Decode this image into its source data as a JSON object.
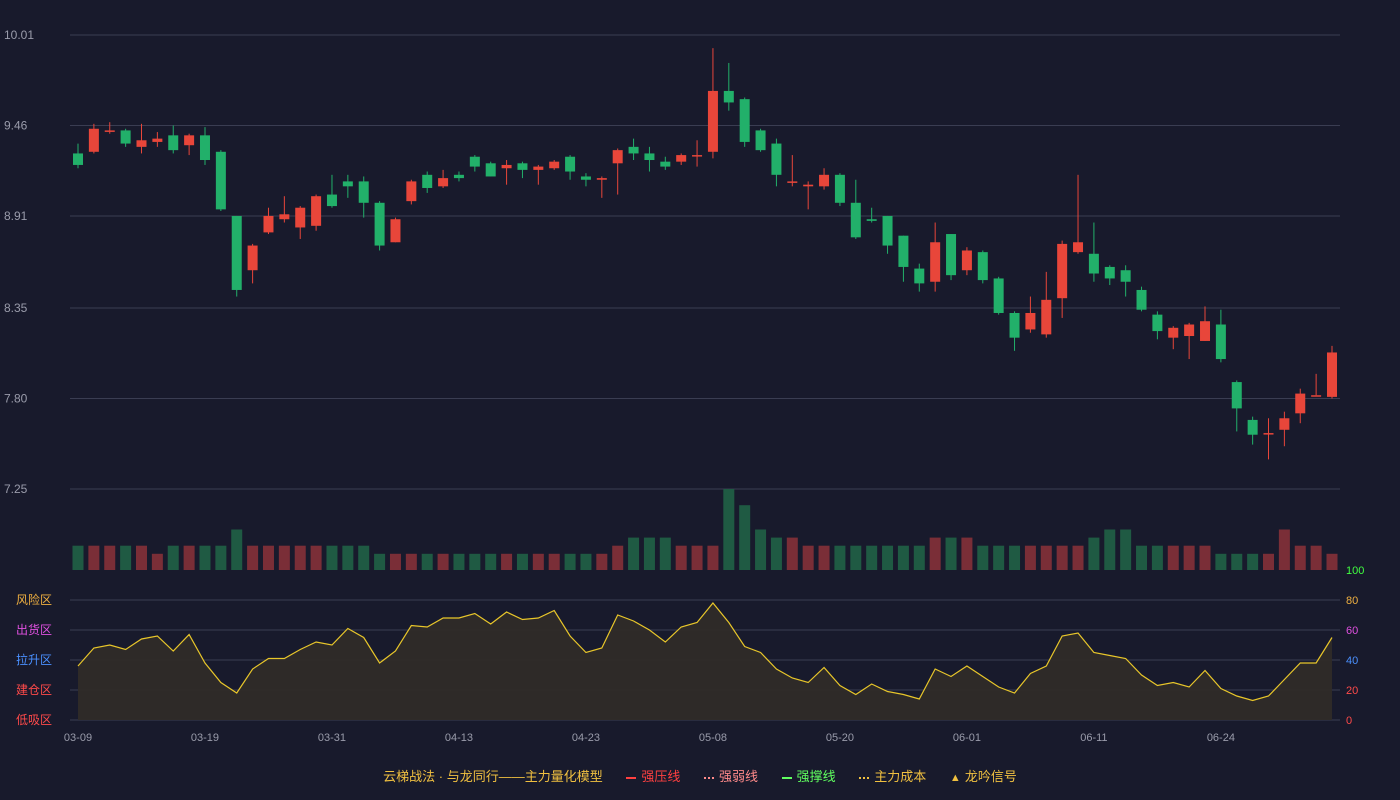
{
  "chart_data": {
    "type": "candlestick",
    "price_axis": {
      "ticks": [
        10.01,
        9.46,
        8.91,
        8.35,
        7.8,
        7.25
      ],
      "ylim": [
        7.25,
        10.01
      ]
    },
    "date_ticks": [
      "03-09",
      "03-19",
      "03-31",
      "04-13",
      "04-23",
      "05-08",
      "05-20",
      "06-01",
      "06-11",
      "06-24"
    ],
    "candles": [
      [
        9.29,
        9.22,
        9.35,
        9.2
      ],
      [
        9.3,
        9.44,
        9.47,
        9.29
      ],
      [
        9.43,
        9.43,
        9.48,
        9.41
      ],
      [
        9.43,
        9.35,
        9.44,
        9.33
      ],
      [
        9.33,
        9.37,
        9.47,
        9.29
      ],
      [
        9.36,
        9.38,
        9.42,
        9.33
      ],
      [
        9.4,
        9.31,
        9.46,
        9.29
      ],
      [
        9.34,
        9.4,
        9.41,
        9.28
      ],
      [
        9.4,
        9.25,
        9.45,
        9.22
      ],
      [
        9.3,
        8.95,
        9.31,
        8.94
      ],
      [
        8.91,
        8.46,
        8.91,
        8.42
      ],
      [
        8.58,
        8.73,
        8.74,
        8.5
      ],
      [
        8.81,
        8.91,
        8.96,
        8.8
      ],
      [
        8.89,
        8.92,
        9.03,
        8.87
      ],
      [
        8.84,
        8.96,
        8.97,
        8.77
      ],
      [
        8.85,
        9.03,
        9.04,
        8.82
      ],
      [
        9.04,
        8.97,
        9.16,
        8.96
      ],
      [
        9.12,
        9.09,
        9.16,
        9.02
      ],
      [
        9.12,
        8.99,
        9.15,
        8.9
      ],
      [
        8.99,
        8.73,
        9.0,
        8.7
      ],
      [
        8.75,
        8.89,
        8.9,
        8.75
      ],
      [
        9.0,
        9.12,
        9.13,
        8.98
      ],
      [
        9.16,
        9.08,
        9.18,
        9.05
      ],
      [
        9.09,
        9.14,
        9.19,
        9.08
      ],
      [
        9.16,
        9.14,
        9.18,
        9.12
      ],
      [
        9.27,
        9.21,
        9.28,
        9.18
      ],
      [
        9.23,
        9.15,
        9.24,
        9.15
      ],
      [
        9.2,
        9.22,
        9.25,
        9.1
      ],
      [
        9.23,
        9.19,
        9.24,
        9.14
      ],
      [
        9.19,
        9.21,
        9.22,
        9.1
      ],
      [
        9.2,
        9.24,
        9.25,
        9.19
      ],
      [
        9.27,
        9.18,
        9.28,
        9.13
      ],
      [
        9.15,
        9.13,
        9.17,
        9.09
      ],
      [
        9.13,
        9.14,
        9.15,
        9.02
      ],
      [
        9.23,
        9.31,
        9.32,
        9.04
      ],
      [
        9.33,
        9.29,
        9.38,
        9.25
      ],
      [
        9.29,
        9.25,
        9.33,
        9.18
      ],
      [
        9.24,
        9.21,
        9.27,
        9.19
      ],
      [
        9.24,
        9.28,
        9.29,
        9.22
      ],
      [
        9.28,
        9.28,
        9.37,
        9.21
      ],
      [
        9.3,
        9.67,
        9.93,
        9.26
      ],
      [
        9.67,
        9.6,
        9.84,
        9.55
      ],
      [
        9.62,
        9.36,
        9.63,
        9.33
      ],
      [
        9.43,
        9.31,
        9.44,
        9.3
      ],
      [
        9.35,
        9.16,
        9.38,
        9.09
      ],
      [
        9.12,
        9.12,
        9.28,
        9.09
      ],
      [
        9.09,
        9.1,
        9.12,
        8.95
      ],
      [
        9.09,
        9.16,
        9.2,
        9.07
      ],
      [
        9.16,
        8.99,
        9.17,
        8.97
      ],
      [
        8.99,
        8.78,
        9.13,
        8.77
      ],
      [
        8.89,
        8.88,
        8.96,
        8.87
      ],
      [
        8.91,
        8.73,
        8.91,
        8.68
      ],
      [
        8.79,
        8.6,
        8.79,
        8.51
      ],
      [
        8.59,
        8.5,
        8.62,
        8.45
      ],
      [
        8.51,
        8.75,
        8.87,
        8.45
      ],
      [
        8.8,
        8.55,
        8.8,
        8.52
      ],
      [
        8.58,
        8.7,
        8.72,
        8.55
      ],
      [
        8.69,
        8.52,
        8.7,
        8.5
      ],
      [
        8.53,
        8.32,
        8.54,
        8.31
      ],
      [
        8.32,
        8.17,
        8.33,
        8.09
      ],
      [
        8.22,
        8.32,
        8.42,
        8.2
      ],
      [
        8.19,
        8.4,
        8.57,
        8.17
      ],
      [
        8.41,
        8.74,
        8.76,
        8.29
      ],
      [
        8.69,
        8.75,
        9.16,
        8.68
      ],
      [
        8.68,
        8.56,
        8.87,
        8.51
      ],
      [
        8.6,
        8.53,
        8.61,
        8.49
      ],
      [
        8.58,
        8.51,
        8.61,
        8.42
      ],
      [
        8.46,
        8.34,
        8.48,
        8.33
      ],
      [
        8.31,
        8.21,
        8.33,
        8.16
      ],
      [
        8.17,
        8.23,
        8.24,
        8.1
      ],
      [
        8.18,
        8.25,
        8.26,
        8.04
      ],
      [
        8.15,
        8.27,
        8.36,
        8.15
      ],
      [
        8.25,
        8.04,
        8.34,
        8.02
      ],
      [
        7.9,
        7.74,
        7.91,
        7.6
      ],
      [
        7.67,
        7.58,
        7.69,
        7.52
      ],
      [
        7.59,
        7.59,
        7.68,
        7.43
      ],
      [
        7.61,
        7.68,
        7.72,
        7.51
      ],
      [
        7.71,
        7.83,
        7.86,
        7.65
      ],
      [
        7.82,
        7.82,
        7.95,
        7.82
      ],
      [
        7.81,
        8.08,
        8.12,
        7.8
      ]
    ],
    "volume_levels": [
      3,
      3,
      3,
      3,
      3,
      2,
      3,
      3,
      3,
      3,
      5,
      3,
      3,
      3,
      3,
      3,
      3,
      3,
      3,
      2,
      2,
      2,
      2,
      2,
      2,
      2,
      2,
      2,
      2,
      2,
      2,
      2,
      2,
      2,
      3,
      4,
      4,
      4,
      3,
      3,
      3,
      10,
      8,
      5,
      4,
      4,
      3,
      3,
      3,
      3,
      3,
      3,
      3,
      3,
      4,
      4,
      4,
      3,
      3,
      3,
      3,
      3,
      3,
      3,
      4,
      5,
      5,
      3,
      3,
      3,
      3,
      3,
      2,
      2,
      2,
      2,
      5,
      3,
      3,
      2,
      2,
      2,
      3
    ],
    "indicator": {
      "ylim": [
        0,
        100
      ],
      "ticks": [
        0,
        20,
        40,
        60,
        80,
        100
      ],
      "zone_labels": [
        "风险区",
        "出货区",
        "拉升区",
        "建仓区",
        "低吸区"
      ],
      "values": [
        36,
        48,
        50,
        47,
        54,
        56,
        46,
        57,
        38,
        25,
        18,
        34,
        41,
        41,
        47,
        52,
        50,
        61,
        55,
        38,
        46,
        63,
        62,
        68,
        68,
        71,
        64,
        72,
        67,
        68,
        73,
        56,
        45,
        48,
        70,
        66,
        60,
        52,
        62,
        65,
        78,
        65,
        49,
        45,
        34,
        28,
        25,
        35,
        23,
        17,
        24,
        19,
        17,
        14,
        34,
        29,
        36,
        29,
        22,
        18,
        31,
        36,
        56,
        58,
        45,
        43,
        41,
        30,
        23,
        25,
        22,
        33,
        21,
        16,
        13,
        16,
        27,
        38,
        38,
        55
      ]
    },
    "legend_entries": [
      "云梯战法 · 与龙同行——主力量化模型",
      "强压线",
      "强弱线",
      "强撑线",
      "主力成本",
      "龙吟信号"
    ]
  },
  "colors": {
    "background": "#181a2c",
    "up": "#e8463a",
    "down": "#22b06a",
    "grid": "#3a3d52",
    "axis_text": "#9a9cab",
    "indicator_line": "#e8c62a",
    "indicator_fill": "#2f2b28",
    "strong_pressure": "#ff4040",
    "weak_line": "#ff8a8a",
    "support_line": "#60ff60",
    "main_cost": "#f0c040",
    "zone_risk": "#f0b040",
    "zone_distribution": "#e050e0",
    "zone_rise": "#4a90ff",
    "zone_accumulate": "#ff4a4a",
    "zone_low_buy": "#ff4a4a",
    "axis_100": "#40ff40",
    "axis_80": "#f0b040",
    "axis_60": "#e050e0",
    "axis_40": "#4a90ff",
    "axis_20": "#ff4a4a",
    "axis_0": "#ff4a4a"
  }
}
